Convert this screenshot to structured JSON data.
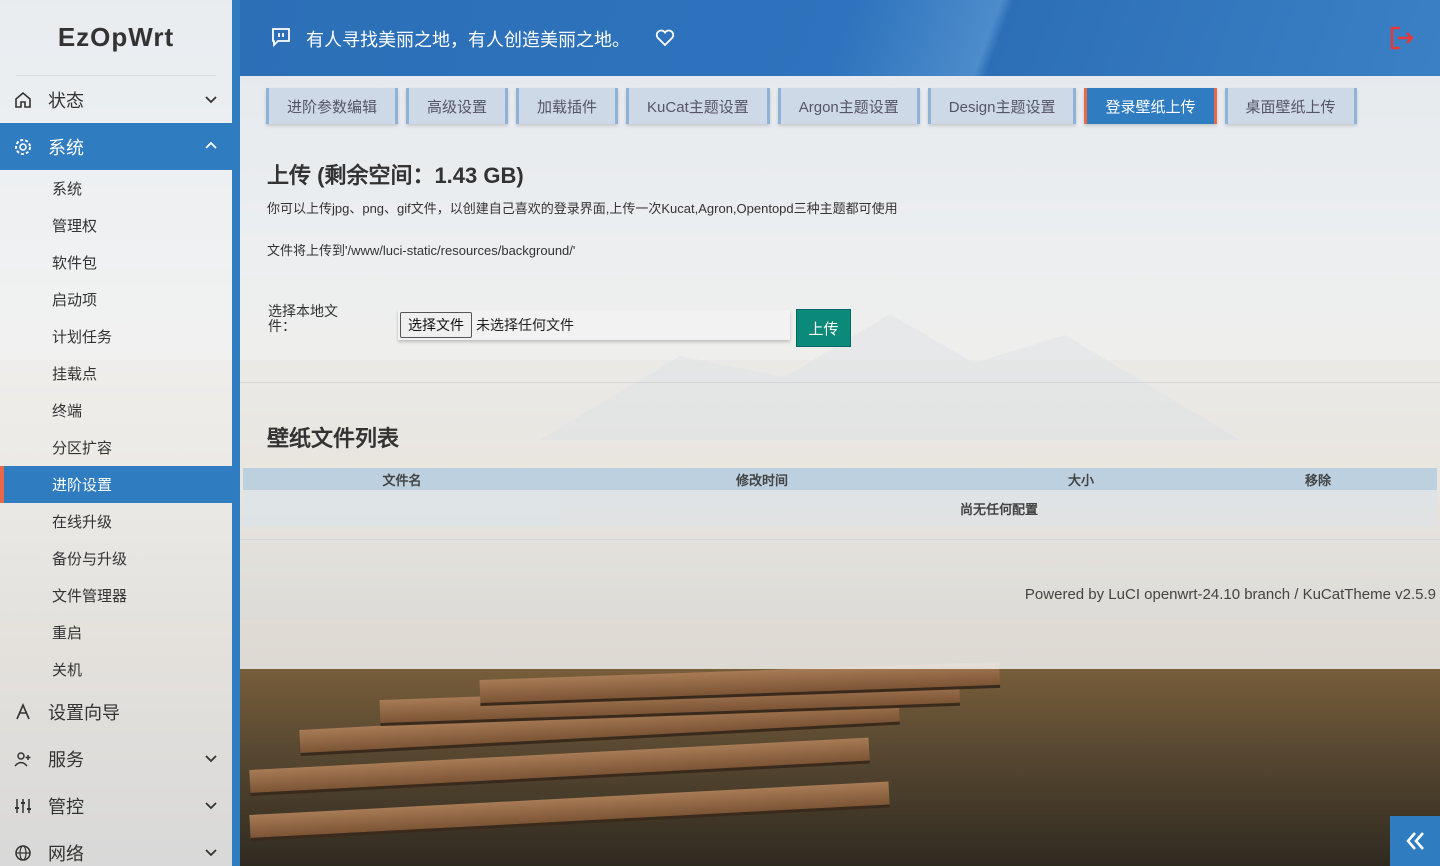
{
  "brand": "EzOpWrt",
  "header": {
    "motto": "有人寻找美丽之地，有人创造美丽之地。"
  },
  "sidebar": {
    "items": [
      {
        "label": "状态",
        "icon": "home-icon",
        "expanded": false
      },
      {
        "label": "系统",
        "icon": "gear-icon",
        "expanded": true,
        "active": true
      },
      {
        "label": "设置向导",
        "icon": "wizard-icon"
      },
      {
        "label": "服务",
        "icon": "users-icon",
        "expanded": false
      },
      {
        "label": "管控",
        "icon": "sliders-icon",
        "expanded": false
      },
      {
        "label": "网络",
        "icon": "globe-icon",
        "expanded": false
      }
    ],
    "system_sub": [
      "系统",
      "管理权",
      "软件包",
      "启动项",
      "计划任务",
      "挂载点",
      "终端",
      "分区扩容",
      "进阶设置",
      "在线升级",
      "备份与升级",
      "文件管理器",
      "重启",
      "关机"
    ],
    "active_sub": "进阶设置"
  },
  "tabs": [
    "进阶参数编辑",
    "高级设置",
    "加载插件",
    "KuCat主题设置",
    "Argon主题设置",
    "Design主题设置",
    "登录壁纸上传",
    "桌面壁纸上传"
  ],
  "active_tab": "登录壁纸上传",
  "upload": {
    "title": "上传 (剩余空间：1.43 GB)",
    "note1": "你可以上传jpg、png、gif文件，以创建自己喜欢的登录界面,上传一次Kucat,Agron,Opentopd三种主题都可使用",
    "note2": "文件将上传到'/www/luci-static/resources/background/'",
    "field_label": "选择本地文件：",
    "choose_button": "选择文件",
    "file_status": "未选择任何文件",
    "upload_button": "上传"
  },
  "list": {
    "title": "壁纸文件列表",
    "columns": [
      "文件名",
      "修改时间",
      "大小",
      "移除"
    ],
    "empty_text": "尚无任何配置"
  },
  "footer": "Powered by LuCI openwrt-24.10 branch / KuCatTheme v2.5.9",
  "colors": {
    "accent": "#2f7cc1",
    "active_marker": "#e8684a",
    "upload_button": "#0b8a79",
    "logout_icon": "#e53935"
  }
}
